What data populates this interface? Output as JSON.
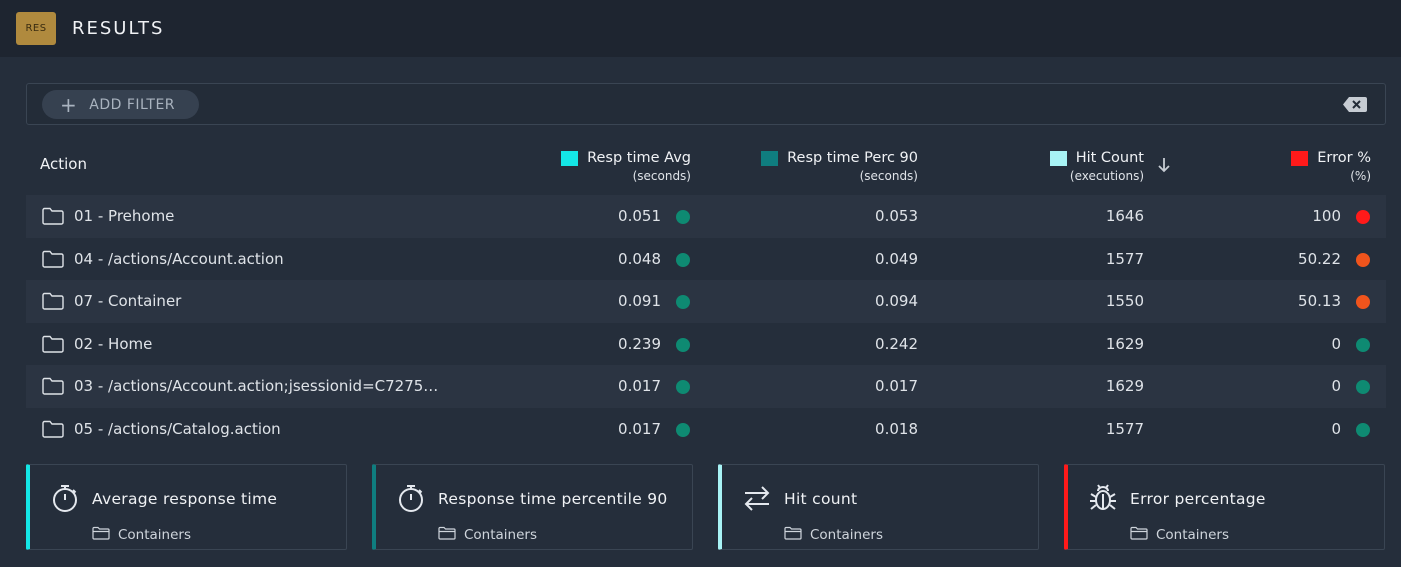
{
  "header": {
    "badge": "RES",
    "title": "RESULTS"
  },
  "filter": {
    "add_label": "ADD FILTER"
  },
  "colors": {
    "avg": "#14e6e6",
    "perc": "#0f7d7f",
    "hit": "#a8f3f5",
    "error": "#ff1a1a",
    "dot_ok": "#0e8a72",
    "dot_err": "#ff1a1a",
    "dot_warn": "#f0541c"
  },
  "table": {
    "columns": {
      "action": "Action",
      "avg": {
        "title": "Resp time Avg",
        "unit": "(seconds)"
      },
      "perc": {
        "title": "Resp time Perc 90",
        "unit": "(seconds)"
      },
      "hit": {
        "title": "Hit Count",
        "unit": "(executions)"
      },
      "error": {
        "title": "Error %",
        "unit": "(%)"
      }
    },
    "rows": [
      {
        "name": "01 - Prehome",
        "avg": "0.051",
        "perc": "0.053",
        "hit": "1646",
        "error": "100",
        "avg_status": "ok",
        "error_status": "err"
      },
      {
        "name": "04 - /actions/Account.action",
        "avg": "0.048",
        "perc": "0.049",
        "hit": "1577",
        "error": "50.22",
        "avg_status": "ok",
        "error_status": "warn"
      },
      {
        "name": "07 - Container",
        "avg": "0.091",
        "perc": "0.094",
        "hit": "1550",
        "error": "50.13",
        "avg_status": "ok",
        "error_status": "warn"
      },
      {
        "name": "02 - Home",
        "avg": "0.239",
        "perc": "0.242",
        "hit": "1629",
        "error": "0",
        "avg_status": "ok",
        "error_status": "ok"
      },
      {
        "name": "03 - /actions/Account.action;jsessionid=C7275…",
        "avg": "0.017",
        "perc": "0.017",
        "hit": "1629",
        "error": "0",
        "avg_status": "ok",
        "error_status": "ok"
      },
      {
        "name": "05 - /actions/Catalog.action",
        "avg": "0.017",
        "perc": "0.018",
        "hit": "1577",
        "error": "0",
        "avg_status": "ok",
        "error_status": "ok"
      }
    ]
  },
  "cards": [
    {
      "title": "Average response time",
      "sub": "Containers",
      "icon": "stopwatch-icon",
      "color": "#14e6e6"
    },
    {
      "title": "Response time percentile 90",
      "sub": "Containers",
      "icon": "stopwatch-icon",
      "color": "#0f7d7f"
    },
    {
      "title": "Hit count",
      "sub": "Containers",
      "icon": "swap-arrows-icon",
      "color": "#a8f3f5"
    },
    {
      "title": "Error percentage",
      "sub": "Containers",
      "icon": "bug-icon",
      "color": "#ff1a1a"
    }
  ]
}
